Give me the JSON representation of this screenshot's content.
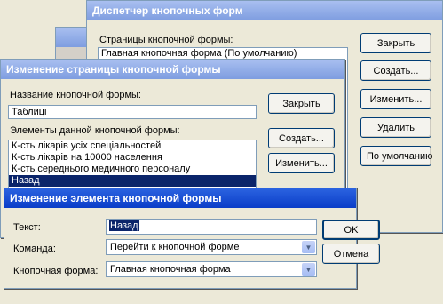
{
  "switchboard_manager": {
    "title": "Диспетчер кнопочных форм",
    "pages_label": "Страницы кнопочной формы:",
    "pages": [
      "Главная кнопочная форма (По умолчанию)"
    ],
    "close_label": "Закрыть",
    "create_label": "Создать...",
    "edit_label": "Изменить...",
    "delete_label": "Удалить",
    "default_label": "По умолчанию"
  },
  "edit_page": {
    "title": "Изменение страницы кнопочной формы",
    "name_label": "Название кнопочной формы:",
    "name_value": "Таблиці",
    "items_label": "Элементы данной кнопочной формы:",
    "items": [
      "К-сть лікарів усіх спеціальностей",
      "К-сть лікарів на 10000 населення",
      "К-сть середнього медичного персоналу",
      "Назад"
    ],
    "selected_index": 3,
    "close_label": "Закрыть",
    "create_label": "Создать...",
    "edit_label": "Изменить..."
  },
  "edit_item": {
    "title": "Изменение элемента кнопочной формы",
    "text_label": "Текст:",
    "text_value": "Назад",
    "command_label": "Команда:",
    "command_value": "Перейти к кнопочной форме",
    "switchboard_label": "Кнопочная форма:",
    "switchboard_value": "Главная кнопочная форма",
    "ok_label": "OK",
    "cancel_label": "Отмена"
  }
}
